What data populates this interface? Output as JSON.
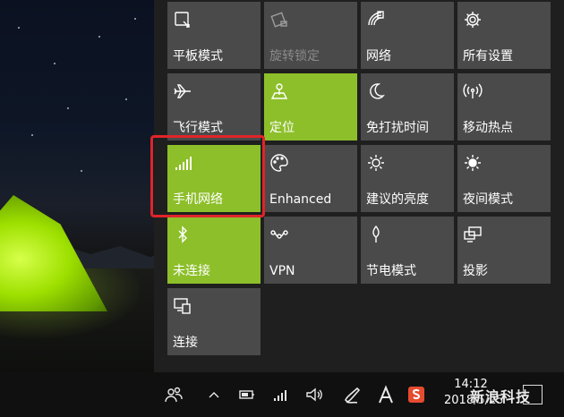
{
  "action_center": {
    "tiles": [
      {
        "label": "平板模式",
        "icon": "tablet-mode-icon",
        "state": "off"
      },
      {
        "label": "旋转锁定",
        "icon": "rotation-lock-icon",
        "state": "disabled"
      },
      {
        "label": "网络",
        "icon": "network-icon",
        "state": "off"
      },
      {
        "label": "所有设置",
        "icon": "settings-gear-icon",
        "state": "off"
      },
      {
        "label": "飞行模式",
        "icon": "airplane-icon",
        "state": "off"
      },
      {
        "label": "定位",
        "icon": "location-icon",
        "state": "on"
      },
      {
        "label": "免打扰时间",
        "icon": "moon-icon",
        "state": "off"
      },
      {
        "label": "移动热点",
        "icon": "hotspot-icon",
        "state": "off"
      },
      {
        "label": "手机网络",
        "icon": "cellular-icon",
        "state": "on"
      },
      {
        "label": "Enhanced",
        "icon": "palette-icon",
        "state": "off"
      },
      {
        "label": "建议的亮度",
        "icon": "brightness-icon",
        "state": "off"
      },
      {
        "label": "夜间模式",
        "icon": "night-light-icon",
        "state": "off"
      },
      {
        "label": "未连接",
        "icon": "bluetooth-icon",
        "state": "on"
      },
      {
        "label": "VPN",
        "icon": "vpn-icon",
        "state": "off"
      },
      {
        "label": "节电模式",
        "icon": "battery-saver-icon",
        "state": "off"
      },
      {
        "label": "投影",
        "icon": "project-icon",
        "state": "off"
      },
      {
        "label": "连接",
        "icon": "connect-icon",
        "state": "off"
      }
    ],
    "highlighted_tile": "手机网络"
  },
  "taskbar": {
    "time": "14:12",
    "date": "2018/5/25",
    "tray_icons": [
      "people-icon",
      "chevron-up-icon",
      "battery-icon",
      "signal-icon",
      "volume-icon",
      "pen-icon",
      "font-a-icon",
      "sogou-ime-icon"
    ]
  },
  "watermark": "新浪科技",
  "colors": {
    "tile_off": "#4a4a4a",
    "tile_on": "#8dbf2a",
    "panel_bg": "#1f1f1f",
    "taskbar_bg": "#101010",
    "highlight": "#e0242a"
  }
}
